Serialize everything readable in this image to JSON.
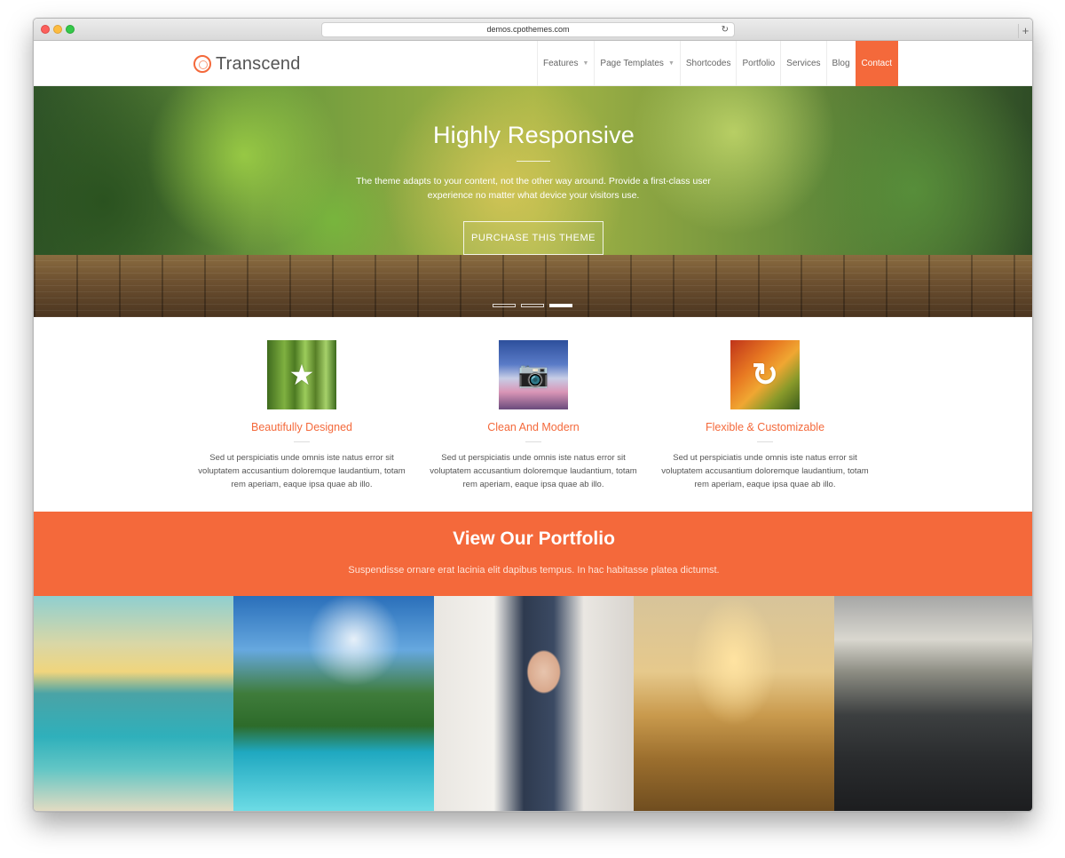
{
  "browser": {
    "url": "demos.cpothemes.com",
    "reload_icon": "↻",
    "newtab_icon": "+"
  },
  "site": {
    "logo_text": "Transcend",
    "nav": [
      {
        "label": "Features",
        "caret": "▼"
      },
      {
        "label": "Page Templates",
        "caret": "▼"
      },
      {
        "label": "Shortcodes"
      },
      {
        "label": "Portfolio"
      },
      {
        "label": "Services"
      },
      {
        "label": "Blog"
      },
      {
        "label": "Contact",
        "active": true
      }
    ]
  },
  "hero": {
    "title": "Highly Responsive",
    "text": "The theme adapts to your content, not the other way around. Provide a first-class user experience no matter what device your visitors use.",
    "button": "PURCHASE THIS THEME",
    "slides": 3,
    "active_slide": 3
  },
  "features": [
    {
      "title": "Beautifully Designed",
      "icon": "star-icon",
      "glyph": "★",
      "text": "Sed ut perspiciatis unde omnis iste natus error sit voluptatem accusantium doloremque laudantium, totam rem aperiam, eaque ipsa quae ab illo."
    },
    {
      "title": "Clean And Modern",
      "icon": "camera-icon",
      "glyph": "📷",
      "text": "Sed ut perspiciatis unde omnis iste natus error sit voluptatem accusantium doloremque laudantium, totam rem aperiam, eaque ipsa quae ab illo."
    },
    {
      "title": "Flexible & Customizable",
      "icon": "refresh-icon",
      "glyph": "↻",
      "text": "Sed ut perspiciatis unde omnis iste natus error sit voluptatem accusantium doloremque laudantium, totam rem aperiam, eaque ipsa quae ab illo."
    }
  ],
  "portfolio": {
    "title": "View Our Portfolio",
    "subtitle": "Suspendisse ornare erat lacinia elit dapibus tempus. In hac habitasse platea dictumst."
  },
  "colors": {
    "accent": "#f4693b",
    "text": "#555555"
  }
}
